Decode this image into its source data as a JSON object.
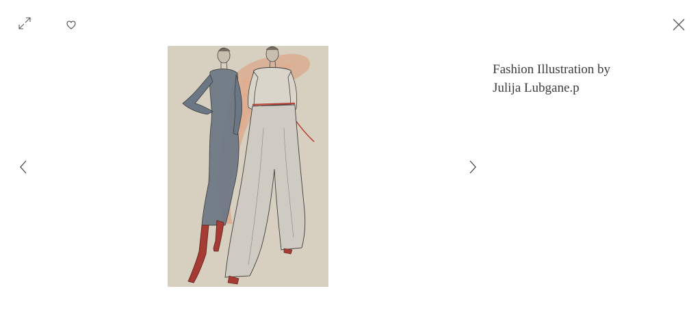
{
  "viewer": {
    "title": "Fashion Illustration by Julija Lubgane.p",
    "title_line1": "Fashion Illustration by",
    "title_line2": "Julija Lubgane.p",
    "artwork_alt": "Fashion illustration of two figures"
  },
  "controls": {
    "expand_icon": "expand-icon",
    "like_icon": "heart-icon",
    "close_icon": "close-icon",
    "prev_icon": "chevron-left-icon",
    "next_icon": "chevron-right-icon"
  },
  "colors": {
    "background": "#ffffff",
    "artwork_bg": "#d7cfbf",
    "icon": "#555555",
    "text": "#3b3b3b"
  }
}
